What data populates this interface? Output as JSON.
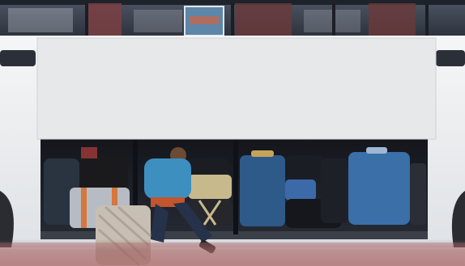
{
  "scene": {
    "subject": "bus-luggage-compartment",
    "billboard": {
      "text": "",
      "color": "#e7e8ea"
    },
    "colors": {
      "bus_body": "#eef0f2",
      "window_glass": "#3a3f4a",
      "curtain": "#6b3a3a",
      "compartment_interior": "#1b1e26",
      "road_tint": "#a86a6a"
    }
  }
}
